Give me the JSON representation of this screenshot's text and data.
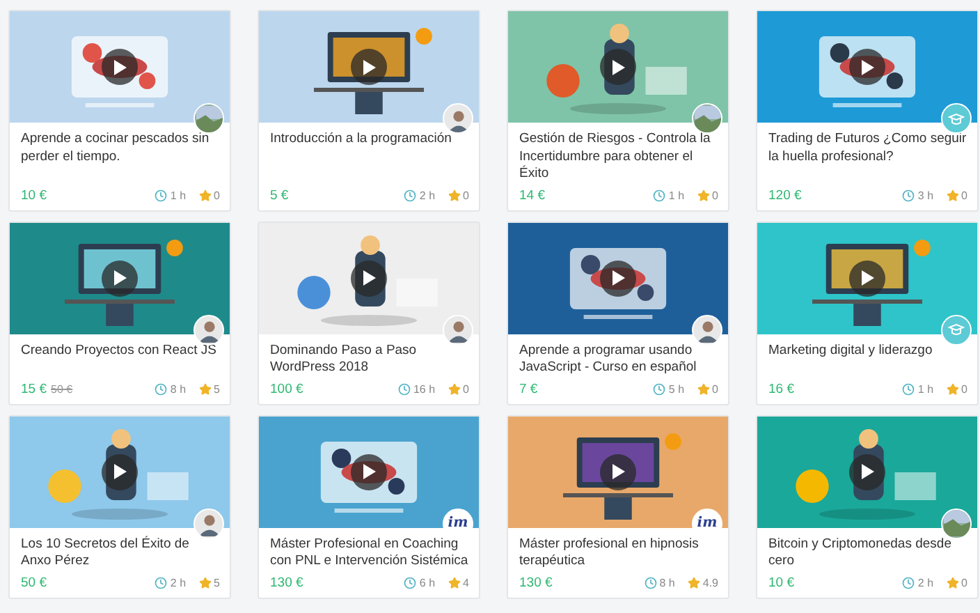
{
  "courses": [
    {
      "title": "Aprende a cocinar pescados sin perder el tiempo.",
      "price": "10 €",
      "duration": "1 h",
      "rating": "0"
    },
    {
      "title": "Introducción a la programación",
      "price": "5 €",
      "duration": "2 h",
      "rating": "0",
      "avatar": {
        "kind": "person"
      }
    },
    {
      "title": "Gestión de Riesgos - Controla la Incertidumbre para obtener el Éxito",
      "price": "14 €",
      "duration": "1 h",
      "rating": "0"
    },
    {
      "title": "Trading de Futuros ¿Como seguir la huella profesional?",
      "price": "120 €",
      "duration": "3 h",
      "rating": "0",
      "avatar": {
        "kind": "emblem"
      }
    },
    {
      "title": "Creando Proyectos con React JS",
      "price": "15 €",
      "old_price": "50 €",
      "duration": "8 h",
      "rating": "5",
      "avatar": {
        "kind": "person"
      }
    },
    {
      "title": "Dominando Paso a Paso WordPress 2018",
      "price": "100 €",
      "duration": "16 h",
      "rating": "0",
      "avatar": {
        "kind": "person"
      }
    },
    {
      "title": "Aprende a programar usando JavaScript - Curso en español",
      "price": "7 €",
      "duration": "5 h",
      "rating": "0",
      "avatar": {
        "kind": "person"
      }
    },
    {
      "title": "Marketing digital y liderazgo",
      "price": "16 €",
      "duration": "1 h",
      "rating": "0",
      "avatar": {
        "kind": "emblem"
      }
    },
    {
      "title": "Los 10 Secretos del Éxito de Anxo Pérez",
      "price": "50 €",
      "duration": "2 h",
      "rating": "5",
      "avatar": {
        "kind": "person"
      }
    },
    {
      "title": "Máster Profesional en Coaching con PNL e Intervención Sistémica",
      "price": "130 €",
      "duration": "6 h",
      "rating": "4",
      "avatar": {
        "kind": "logo",
        "text": "im"
      }
    },
    {
      "title": "Máster profesional en hipnosis terapéutica",
      "price": "130 €",
      "duration": "8 h",
      "rating": "4.9",
      "avatar": {
        "kind": "logo",
        "text": "im"
      }
    },
    {
      "title": "Bitcoin y Criptomonedas desde cero",
      "price": "10 €",
      "duration": "2 h",
      "rating": "0"
    }
  ]
}
